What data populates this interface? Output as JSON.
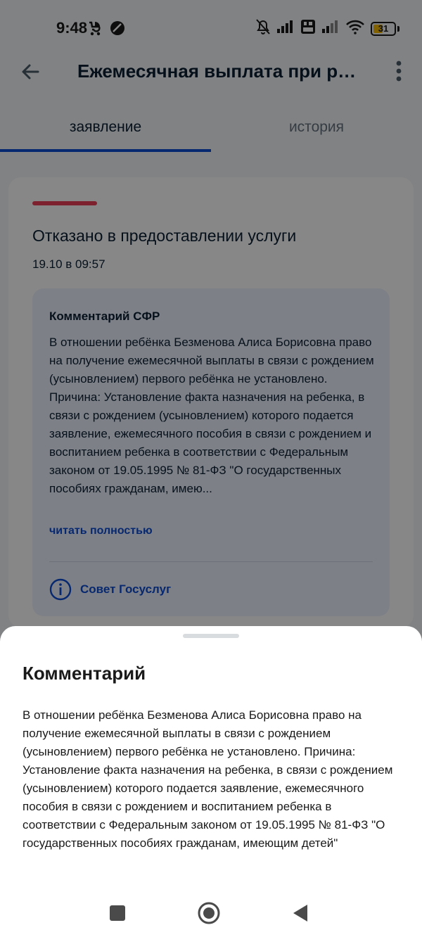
{
  "status_bar": {
    "time": "9:48",
    "left_icons": [
      "stroller-icon",
      "no-disturb-icon"
    ],
    "right_icons": [
      "bell-off-icon",
      "signal-icon",
      "volte-icon",
      "signal-icon",
      "wifi-icon"
    ],
    "battery": "31"
  },
  "header": {
    "title": "Ежемесячная выплата при ро...",
    "back_icon": "arrow-left-icon",
    "menu_icon": "more-vert-icon"
  },
  "tabs": [
    {
      "label": "заявление",
      "active": true
    },
    {
      "label": "история",
      "active": false
    }
  ],
  "card": {
    "status_color": "#ee3f58",
    "status_title": "Отказано в предоставлении услуги",
    "date": "19.10 в 09:57",
    "comment_heading": "Комментарий СФР",
    "comment_preview": "В отношении ребёнка Безменова Алиса Борисовна право на получение ежемесячной выплаты в связи с рождением (усыновлением) первого ребёнка не установлено. Причина: Установление факта назначения на ребенка, в связи с рождением (усыновлением) которого подается заявление, ежемесячного пособия в связи с рождением и воспитанием ребенка в соответствии с Федеральным законом от 19.05.1995 № 81-ФЗ \"О государственных пособиях гражданам, имею...",
    "read_more": "читать полностью",
    "advice_icon": "info-icon",
    "advice": "Совет Госуслуг"
  },
  "sheet": {
    "title": "Комментарий",
    "text": "В отношении ребёнка Безменова Алиса Борисовна право на получение ежемесячной выплаты в связи с рождением (усыновлением) первого ребёнка не установлено. Причина: Установление факта назначения на ребенка, в связи с рождением (усыновлением) которого подается заявление, ежемесячного пособия в связи с рождением и воспитанием ребенка в соответствии с Федеральным законом от 19.05.1995 № 81-ФЗ \"О государственных пособиях гражданам, имеющим детей\""
  },
  "nav": [
    "recents-icon",
    "home-icon",
    "back-icon"
  ],
  "colors": {
    "accent": "#0d4cd3",
    "refused": "#ee3f58",
    "comment_bg": "#edf2fe"
  }
}
